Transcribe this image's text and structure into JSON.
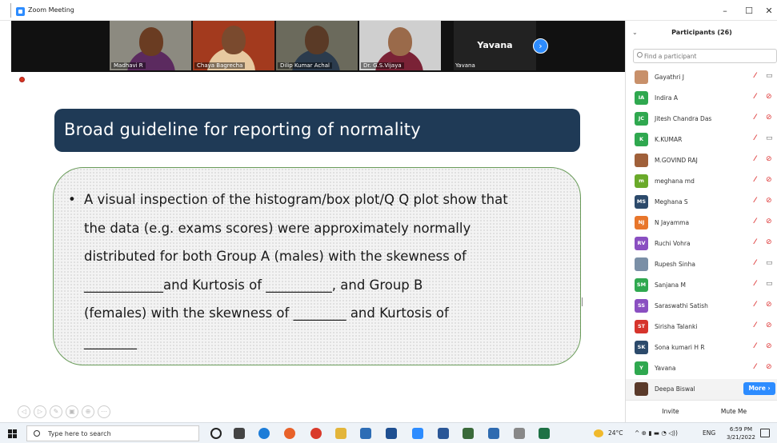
{
  "window": {
    "title": "Zoom Meeting",
    "minimize": "–",
    "maximize": "☐",
    "close": "✕"
  },
  "video_tiles": [
    {
      "name": "Madhavi R"
    },
    {
      "name": "Chaya Bagrecha"
    },
    {
      "name": "Dilip Kumar Achal"
    },
    {
      "name": "Dr. G.S.Vijaya"
    }
  ],
  "active_speaker": {
    "big_name": "Yavana",
    "small_name": "Yavana"
  },
  "next_button": "›",
  "slide": {
    "title": "Broad guideline for reporting of normality",
    "lines": [
      "A visual inspection of the histogram/box plot/Q Q plot show that",
      "the data (e.g. exams scores) were approximately normally",
      "distributed for both Group A (males) with the skewness of",
      "____________and Kurtosis of __________, and Group B",
      "(females) with the skewness of ________ and Kurtosis of",
      "________"
    ],
    "tools": [
      "◁",
      "▷",
      "✎",
      "▣",
      "⊕",
      "⋯"
    ]
  },
  "participants_panel": {
    "collapse": "⌄",
    "title": "Participants (26)",
    "search_placeholder": "Find a participant",
    "participants": [
      {
        "name": "Gayathri J",
        "initials": "",
        "color": "#c8906a",
        "photo": true,
        "mic": "🎤",
        "cam": "▭",
        "cam_on": true
      },
      {
        "name": "Indira A",
        "initials": "IA",
        "color": "#2fa84f",
        "photo": false,
        "mic": "🎤",
        "cam": "⊘",
        "cam_on": false
      },
      {
        "name": "Jitesh Chandra Das",
        "initials": "JC",
        "color": "#2fa84f",
        "photo": false,
        "mic": "🎤",
        "cam": "⊘",
        "cam_on": false
      },
      {
        "name": "K.KUMAR",
        "initials": "K",
        "color": "#2fa84f",
        "photo": false,
        "mic": "🎤",
        "cam": "▭",
        "cam_on": true
      },
      {
        "name": "M.GOVIND RAJ",
        "initials": "",
        "color": "#a0603a",
        "photo": true,
        "mic": "🎤",
        "cam": "⊘",
        "cam_on": false
      },
      {
        "name": "meghana md",
        "initials": "m",
        "color": "#6aaa2a",
        "photo": false,
        "mic": "🎤",
        "cam": "⊘",
        "cam_on": false
      },
      {
        "name": "Meghana S",
        "initials": "MS",
        "color": "#2c4a6b",
        "photo": false,
        "mic": "🎤",
        "cam": "⊘",
        "cam_on": false
      },
      {
        "name": "N Jayamma",
        "initials": "NJ",
        "color": "#e8762b",
        "photo": false,
        "mic": "🎤",
        "cam": "⊘",
        "cam_on": false
      },
      {
        "name": "Ruchi Vohra",
        "initials": "RV",
        "color": "#8a4fc1",
        "photo": false,
        "mic": "🎤",
        "cam": "⊘",
        "cam_on": false
      },
      {
        "name": "Rupesh Sinha",
        "initials": "",
        "color": "#7a8fa6",
        "photo": true,
        "mic": "🎤",
        "cam": "▭",
        "cam_on": true
      },
      {
        "name": "Sanjana M",
        "initials": "SM",
        "color": "#2fa84f",
        "photo": false,
        "mic": "🎤",
        "cam": "▭",
        "cam_on": true
      },
      {
        "name": "Saraswathi Satish",
        "initials": "SS",
        "color": "#8a4fc1",
        "photo": false,
        "mic": "🎤",
        "cam": "⊘",
        "cam_on": false
      },
      {
        "name": "Sirisha Talanki",
        "initials": "ST",
        "color": "#d6342c",
        "photo": false,
        "mic": "🎤",
        "cam": "⊘",
        "cam_on": false
      },
      {
        "name": "Sona kumari H R",
        "initials": "SK",
        "color": "#2c4a6b",
        "photo": false,
        "mic": "🎤",
        "cam": "⊘",
        "cam_on": false
      },
      {
        "name": "Yavana",
        "initials": "Y",
        "color": "#2fa84f",
        "photo": false,
        "mic": "🎤",
        "cam": "⊘",
        "cam_on": false
      }
    ],
    "last_participant": {
      "name": "Deepa Biswal",
      "color": "#5a3a2a"
    },
    "more_label": "More ›",
    "invite_label": "Invite",
    "mute_me_label": "Mute Me"
  },
  "taskbar": {
    "search_placeholder": "Type here to search",
    "temperature": "24°C",
    "tray_icons": "^ ⊕ ▮ ▬ ◔ ◁))",
    "language": "ENG",
    "time": "6:59 PM",
    "date": "3/21/2022"
  }
}
